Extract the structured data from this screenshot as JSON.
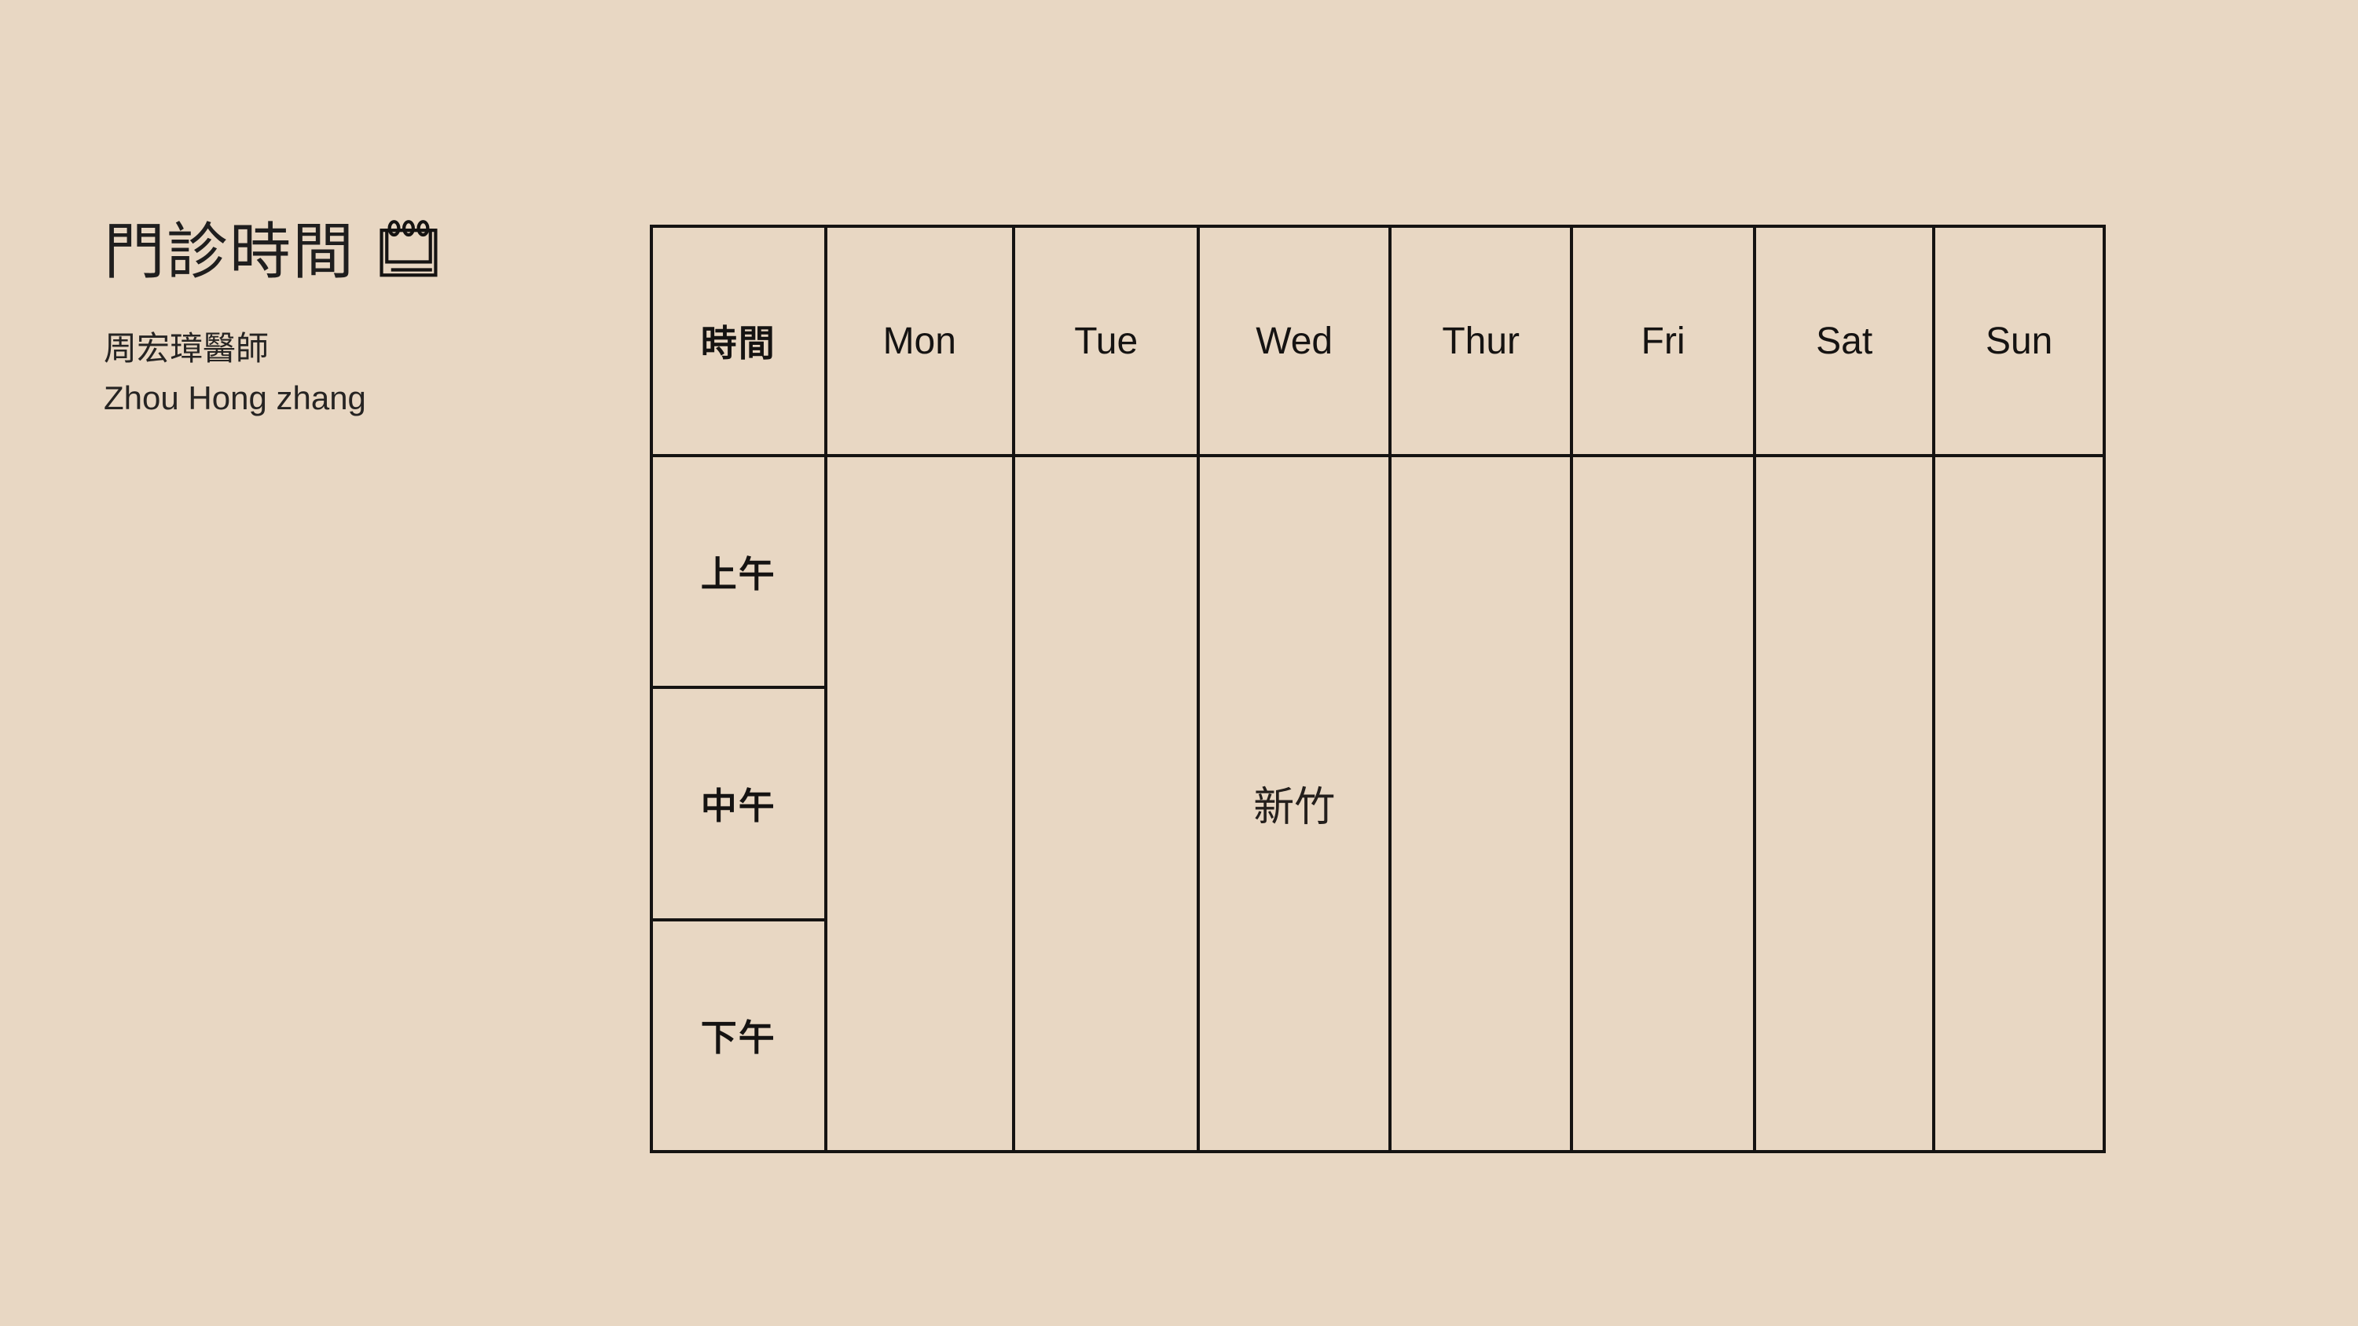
{
  "page": {
    "background_color": "#e8d7c3",
    "ink_color": "#151312"
  },
  "header": {
    "title": "門診時間",
    "title_icon": "notepad-calendar-icon",
    "doctor_name_zh": "周宏璋醫師",
    "doctor_name_en": "Zhou Hong zhang"
  },
  "schedule": {
    "columns": [
      {
        "key": "time",
        "label": "時間",
        "bold": true
      },
      {
        "key": "mon",
        "label": "Mon",
        "bold": false
      },
      {
        "key": "tue",
        "label": "Tue",
        "bold": false
      },
      {
        "key": "wed",
        "label": "Wed",
        "bold": false
      },
      {
        "key": "thur",
        "label": "Thur",
        "bold": false
      },
      {
        "key": "fri",
        "label": "Fri",
        "bold": false
      },
      {
        "key": "sat",
        "label": "Sat",
        "bold": false
      },
      {
        "key": "sun",
        "label": "Sun",
        "bold": false
      }
    ],
    "rows": [
      {
        "key": "morning",
        "label": "上午"
      },
      {
        "key": "noon",
        "label": "中午"
      },
      {
        "key": "afternoon",
        "label": "下午"
      }
    ],
    "cells": {
      "morning": {
        "mon": "",
        "tue": "",
        "wed": "",
        "thur": "",
        "fri": "",
        "sat": "",
        "sun": ""
      },
      "noon": {
        "mon": "",
        "tue": "",
        "wed": "新竹",
        "thur": "",
        "fri": "",
        "sat": "",
        "sun": ""
      },
      "afternoon": {
        "mon": "",
        "tue": "",
        "wed": "",
        "thur": "",
        "fri": "",
        "sat": "",
        "sun": ""
      }
    }
  }
}
